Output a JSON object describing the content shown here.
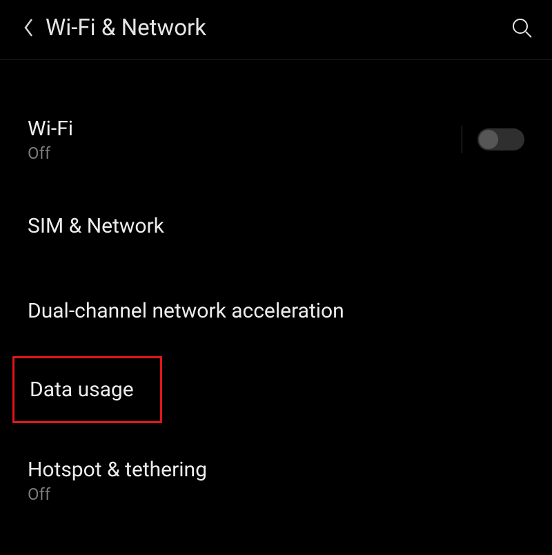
{
  "header": {
    "title": "Wi-Fi & Network"
  },
  "items": {
    "wifi": {
      "title": "Wi-Fi",
      "sub": "Off",
      "toggled": false
    },
    "sim": {
      "title": "SIM & Network"
    },
    "dual": {
      "title": "Dual-channel network acceleration"
    },
    "data_usage": {
      "title": "Data usage"
    },
    "hotspot": {
      "title": "Hotspot & tethering",
      "sub": "Off"
    }
  }
}
